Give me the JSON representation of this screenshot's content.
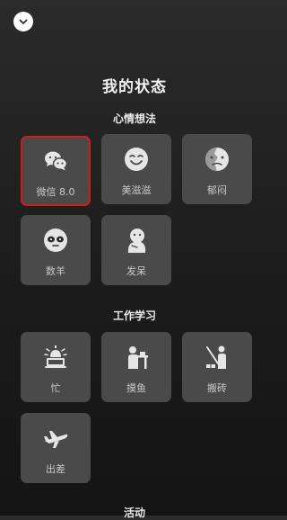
{
  "page": {
    "title": "我的状态"
  },
  "sections": [
    {
      "title": "心情想法",
      "items": [
        {
          "label": "微信 8.0",
          "icon": "chat-bubbles-icon",
          "selected": true
        },
        {
          "label": "美滋滋",
          "icon": "smiley-icon",
          "selected": false
        },
        {
          "label": "郁闷",
          "icon": "gloomy-face-icon",
          "selected": false
        },
        {
          "label": "数羊",
          "icon": "sheep-icon",
          "selected": false
        },
        {
          "label": "发呆",
          "icon": "zoned-out-icon",
          "selected": false
        }
      ]
    },
    {
      "title": "工作学习",
      "items": [
        {
          "label": "忙",
          "icon": "alarm-laptop-icon",
          "selected": false
        },
        {
          "label": "摸鱼",
          "icon": "slacking-desk-icon",
          "selected": false
        },
        {
          "label": "搬砖",
          "icon": "brick-carrying-icon",
          "selected": false
        },
        {
          "label": "出差",
          "icon": "airplane-icon",
          "selected": false
        }
      ]
    },
    {
      "title": "活动",
      "items": []
    }
  ],
  "colors": {
    "background_top": "#2b2b2b",
    "background_bottom": "#141414",
    "tile": "#4a4a4a",
    "selection_border": "#d71b1b",
    "label": "#c9c9c9"
  }
}
